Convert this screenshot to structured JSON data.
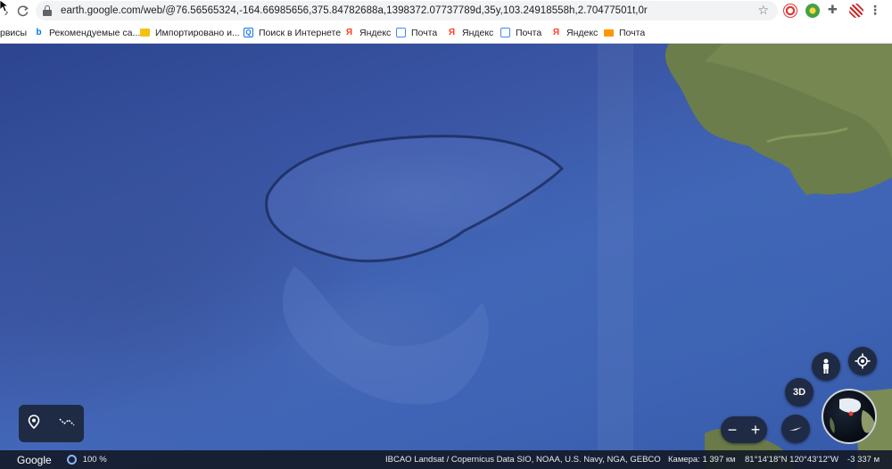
{
  "browser": {
    "url": "earth.google.com/web/@76.56565324,-164.66985656,375.84782688a,1398372.07737789d,35y,103.24918558h,2.70477501t,0r"
  },
  "bookmarks": [
    {
      "label": "рвисы",
      "icon": "none"
    },
    {
      "label": "Рекомендуемые са...",
      "icon": "bing-icon",
      "color": "#0078d7"
    },
    {
      "label": "Импортировано и...",
      "icon": "folder-icon",
      "color": "#f4c20d"
    },
    {
      "label": "Поиск в Интернете",
      "icon": "search-icon",
      "color": "#1a73e8"
    },
    {
      "label": "Яндекс",
      "icon": "yandex-icon",
      "color": "#fc3f1d"
    },
    {
      "label": "Почта",
      "icon": "mail-icon",
      "color": "#4285f4"
    },
    {
      "label": "Яндекс",
      "icon": "yandex-icon",
      "color": "#fc3f1d"
    },
    {
      "label": "Почта",
      "icon": "mail-icon",
      "color": "#4285f4"
    },
    {
      "label": "Яндекс",
      "icon": "yandex-icon",
      "color": "#fc3f1d"
    },
    {
      "label": "Почта",
      "icon": "mail-icon",
      "color": "#ff9800"
    }
  ],
  "map": {
    "controls": {
      "btn_3d": "3D",
      "zoom_out": "−",
      "zoom_in": "+"
    },
    "status": {
      "logo": "Google",
      "zoom": "100 %",
      "credits": "IBCAO  Landsat / Copernicus  Data SIO, NOAA, U.S. Navy, NGA, GEBCO",
      "camera": "Камера: 1 397 км",
      "coords": "81°14'18\"N 120°43'12\"W",
      "elevation": "-3 337 м"
    }
  }
}
